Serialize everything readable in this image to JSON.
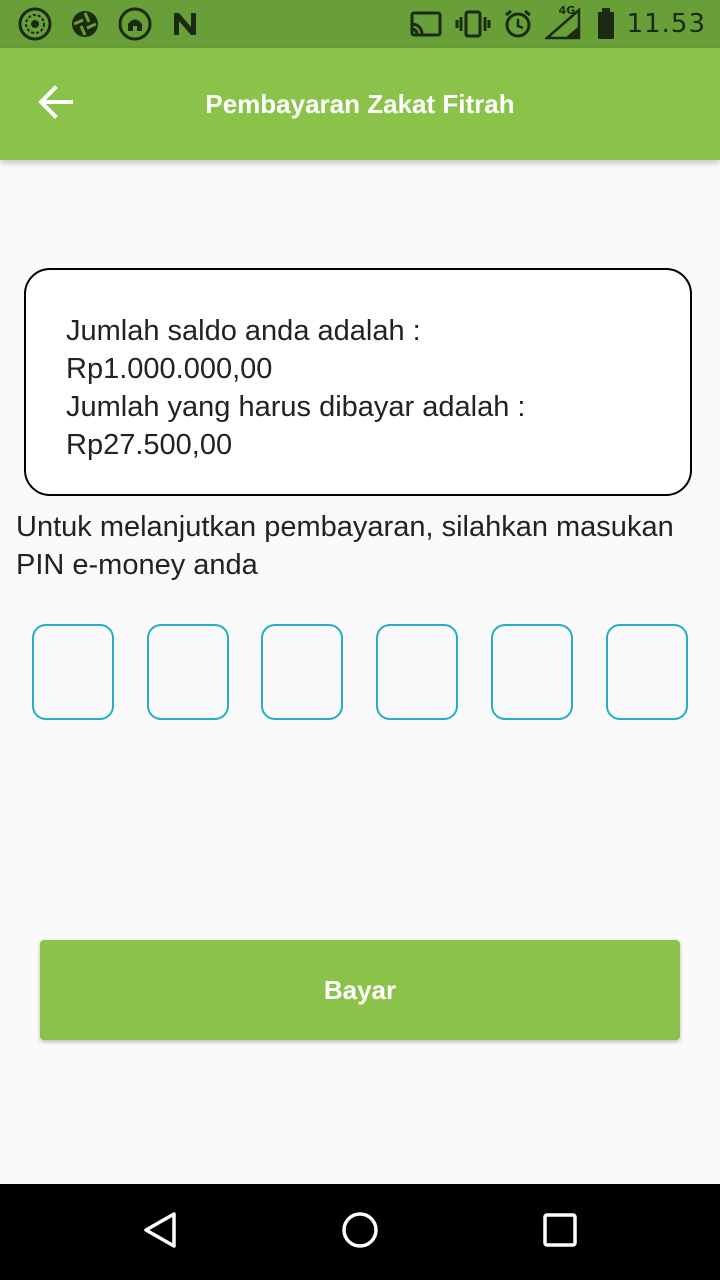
{
  "status_bar": {
    "time": "11.53",
    "network": "4G",
    "left_icons": [
      "quran-app-icon",
      "aperture-icon",
      "mosque-badge-icon",
      "n-app-icon"
    ],
    "right_icons": [
      "cast-icon",
      "vibrate-icon",
      "alarm-icon",
      "signal-icon",
      "battery-icon"
    ]
  },
  "app_bar": {
    "title": "Pembayaran Zakat Fitrah",
    "back_icon": "arrow-back-icon"
  },
  "balance_card": {
    "balance_label": "Jumlah saldo anda adalah :",
    "balance_value": "Rp1.000.000,00",
    "due_label": "Jumlah yang harus dibayar adalah :",
    "due_value": "Rp27.500,00"
  },
  "instruction": "Untuk melanjutkan pembayaran, silahkan masukan PIN e-money anda",
  "pin": {
    "length": 6,
    "values": [
      "",
      "",
      "",
      "",
      "",
      ""
    ]
  },
  "pay_button": {
    "label": "Bayar"
  },
  "nav_bar": {
    "icons": [
      "back-triangle-icon",
      "home-circle-icon",
      "recents-square-icon"
    ]
  },
  "colors": {
    "status_bar": "#689f38",
    "app_bar": "#8bc34a",
    "pin_border": "#26aec4",
    "background": "#fafafa",
    "nav_bar": "#000000"
  }
}
